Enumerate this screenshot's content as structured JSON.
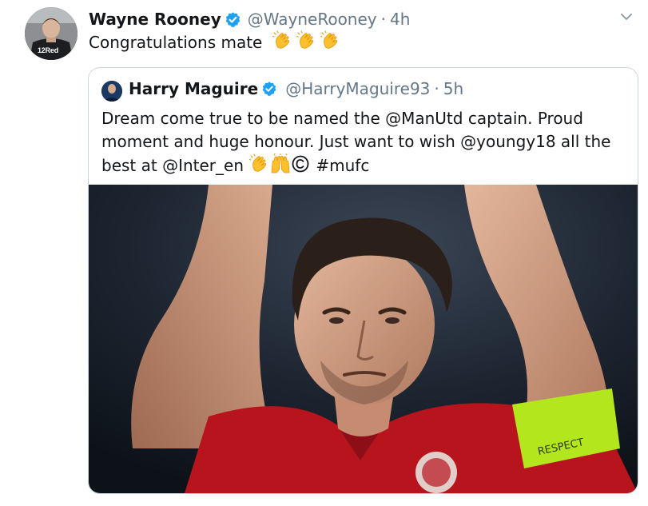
{
  "tweet": {
    "author_name": "Wayne Rooney",
    "author_handle": "@WayneRooney",
    "separator": "·",
    "time": "4h",
    "text": "Congratulations mate",
    "text_emoji": [
      "clapping-hands",
      "clapping-hands",
      "clapping-hands"
    ],
    "avatar_badge": "12Red"
  },
  "quoted_tweet": {
    "author_name": "Harry Maguire",
    "author_handle": "@HarryMaguire93",
    "separator": "·",
    "time": "5h",
    "text_line1": "Dream come true to be named the @ManUtd captain. Proud",
    "text_line2": "moment and huge honour. Just want to wish @youngy18 all the",
    "text_line3_start": "best at @Inter_en",
    "text_line3_emoji": [
      "clapping-hands",
      "raising-hands",
      "copyright-sign"
    ],
    "text_line3_end": "#mufc",
    "armband_text": "RESPECT"
  },
  "colors": {
    "verified": "#1da1f2",
    "secondary_text": "#657786",
    "border": "#ccd6dd",
    "shirt": "#b8141e",
    "armband": "#b4e61e"
  }
}
